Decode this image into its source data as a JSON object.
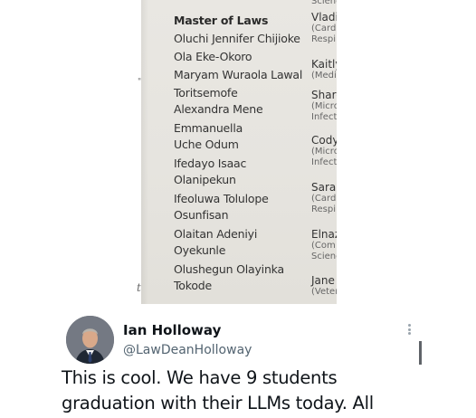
{
  "program": {
    "heading": "Master of Laws",
    "graduates": [
      [
        "Oluchi Jennifer Chijioke"
      ],
      [
        "Ola Eke-Okoro"
      ],
      [
        "Maryam Wuraola Lawal"
      ],
      [
        "Toritsemofe",
        "Alexandra Mene"
      ],
      [
        "Emmanuella",
        "Uche Odum"
      ],
      [
        "Ifedayo Isaac",
        "Olanipekun"
      ],
      [
        "Ifeoluwa Tolulope",
        "Osunfisan"
      ],
      [
        "Olaitan Adeniyi",
        "Oyekunle"
      ],
      [
        "Olushegun Olayinka",
        "Tokode"
      ]
    ],
    "right_column": {
      "top_fragment": "Scienc",
      "entries": [
        {
          "name": "Vladi",
          "sub": [
            "(Cardi",
            "Respi"
          ]
        },
        {
          "name": "Kaitly",
          "sub": [
            "(Medi"
          ]
        },
        {
          "name": "Sharo",
          "sub": [
            "(Micro",
            "Infect"
          ]
        },
        {
          "name": "Cody",
          "sub": [
            "(Micro",
            "Infect"
          ]
        },
        {
          "name": "Saral",
          "sub": [
            "(Card",
            "Respi"
          ]
        },
        {
          "name": "Elnaz",
          "sub": [
            "(Com",
            "Scienc"
          ]
        },
        {
          "name": "Jane",
          "sub": [
            "(Veter"
          ]
        }
      ]
    },
    "left_margin_marks": [
      "\"",
      "t"
    ]
  },
  "tweet": {
    "author_name": "Ian Holloway",
    "author_handle": "@LawDeanHolloway",
    "text": "This is cool. We have 9 students\ngraduation with their LLMs today. All"
  },
  "icons": {
    "more": "more-options-icon",
    "avatar": "profile-photo"
  },
  "colors": {
    "text_primary": "#0f1419",
    "text_secondary": "#536471",
    "page_background": "#e7e5e0"
  }
}
